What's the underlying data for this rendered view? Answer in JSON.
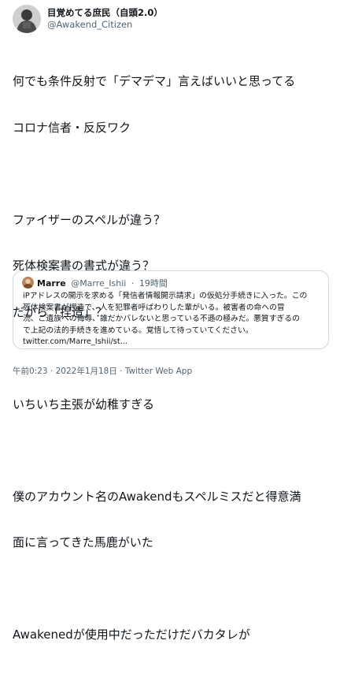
{
  "author": {
    "display_name": "目覚めてる庶民（自頭2.0）",
    "handle": "@Awakend_Citizen"
  },
  "tweet": {
    "lines": [
      "何でも条件反射で「デマデマ」言えばいいと思ってる",
      "コロナ信者・反反ワク",
      "",
      "ファイザーのスペルが違う？",
      "死体検案書の書式が違う？",
      "だから「捏造」？",
      "",
      "いちいち主張が幼稚すぎる",
      "",
      "僕のアカウント名のAwakendもスペルミスだと得意満",
      "面に言ってきた馬鹿がいた",
      "",
      "Awakenedが使用中だっただけだバカタレが"
    ]
  },
  "quoted": {
    "name": "Marre",
    "handle": "@Marre_Ishii",
    "separator": "·",
    "time": "19時間",
    "lines": [
      "iPアドレスの開示を求める「発信者情報開示請求」の仮処分手続きに入った。この",
      "死体検案書が捏造で、人を犯罪者呼ばわりした輩がいる。被害者の命への冒",
      "涜、ご遺族への侮辱、誰だかバレないと思っている不遜の極みだ。悪質すぎるの",
      "で上記の法的手続きを進めている。覚悟して待っていてください。",
      "twitter.com/Marre_Ishii/st..."
    ]
  },
  "footer": {
    "text": "午前0:23 · 2022年1月18日 · Twitter Web App"
  }
}
